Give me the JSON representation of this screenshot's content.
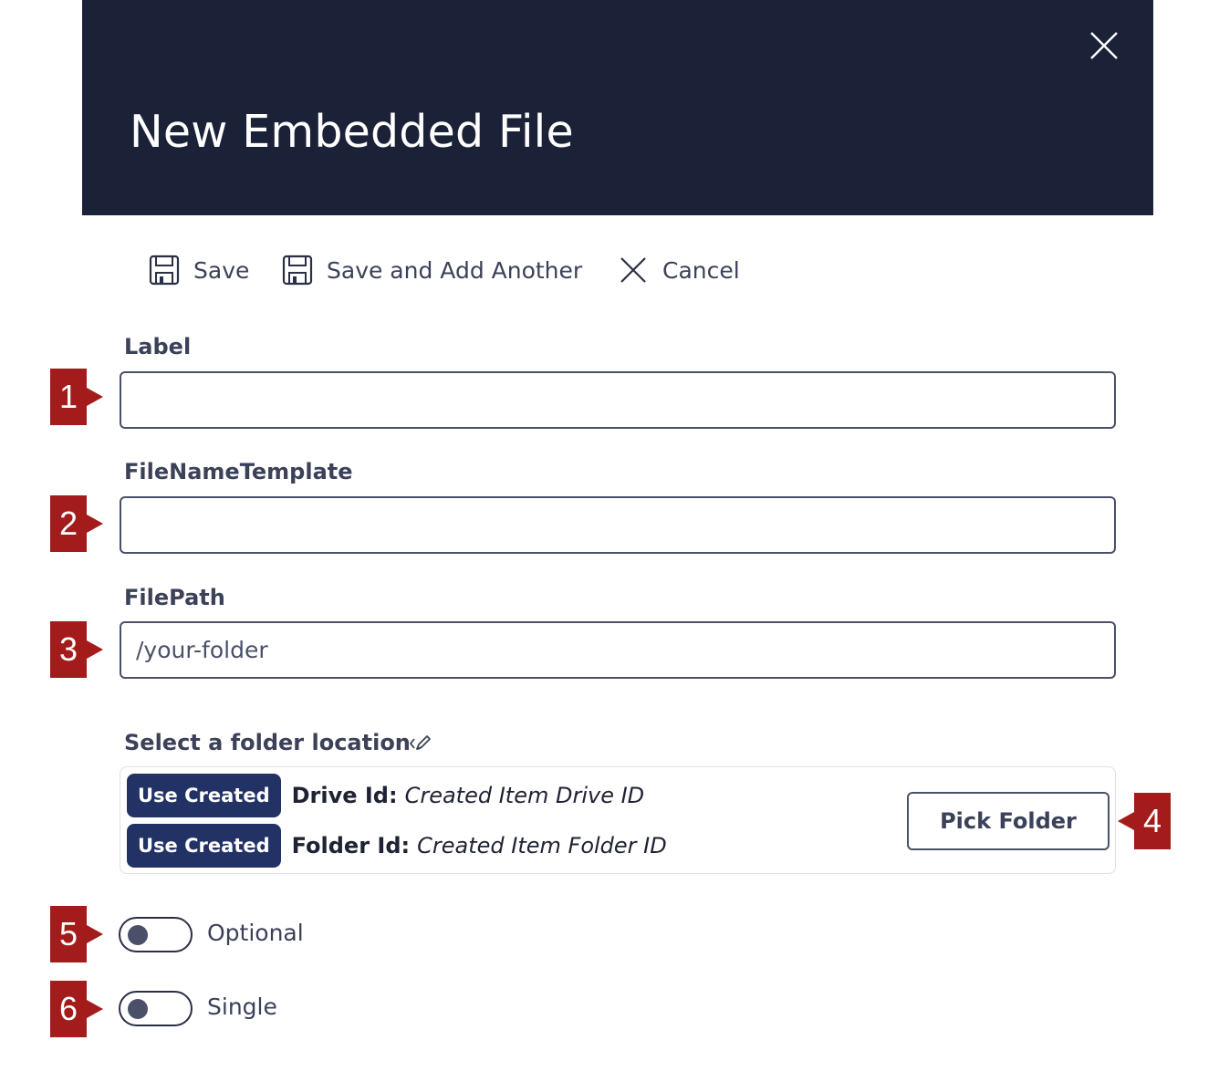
{
  "dialog": {
    "title": "New Embedded File",
    "close_icon": "close-icon"
  },
  "toolbar": {
    "save_label": "Save",
    "save_add_label": "Save and Add Another",
    "cancel_label": "Cancel"
  },
  "form": {
    "label_field": {
      "label": "Label",
      "value": "",
      "placeholder": ""
    },
    "filename_field": {
      "label": "FileNameTemplate",
      "value": "",
      "placeholder": ""
    },
    "filepath_field": {
      "label": "FilePath",
      "value": "",
      "placeholder": "/your-folder"
    }
  },
  "folder": {
    "section_label": "Select a folder location",
    "edit_icon": "code-edit-icon",
    "rows": [
      {
        "button": "Use Created",
        "key": "Drive Id:",
        "value": "Created Item Drive ID"
      },
      {
        "button": "Use Created",
        "key": "Folder Id:",
        "value": "Created Item Folder ID"
      }
    ],
    "pick_label": "Pick Folder"
  },
  "toggles": [
    {
      "label": "Optional",
      "on": false
    },
    {
      "label": "Single",
      "on": false
    }
  ],
  "annotations": [
    "1",
    "2",
    "3",
    "4",
    "5",
    "6"
  ],
  "colors": {
    "header_bg": "#1b2238",
    "button_bg": "#233265",
    "annotation": "#a31b1b",
    "text": "#3b4158"
  }
}
